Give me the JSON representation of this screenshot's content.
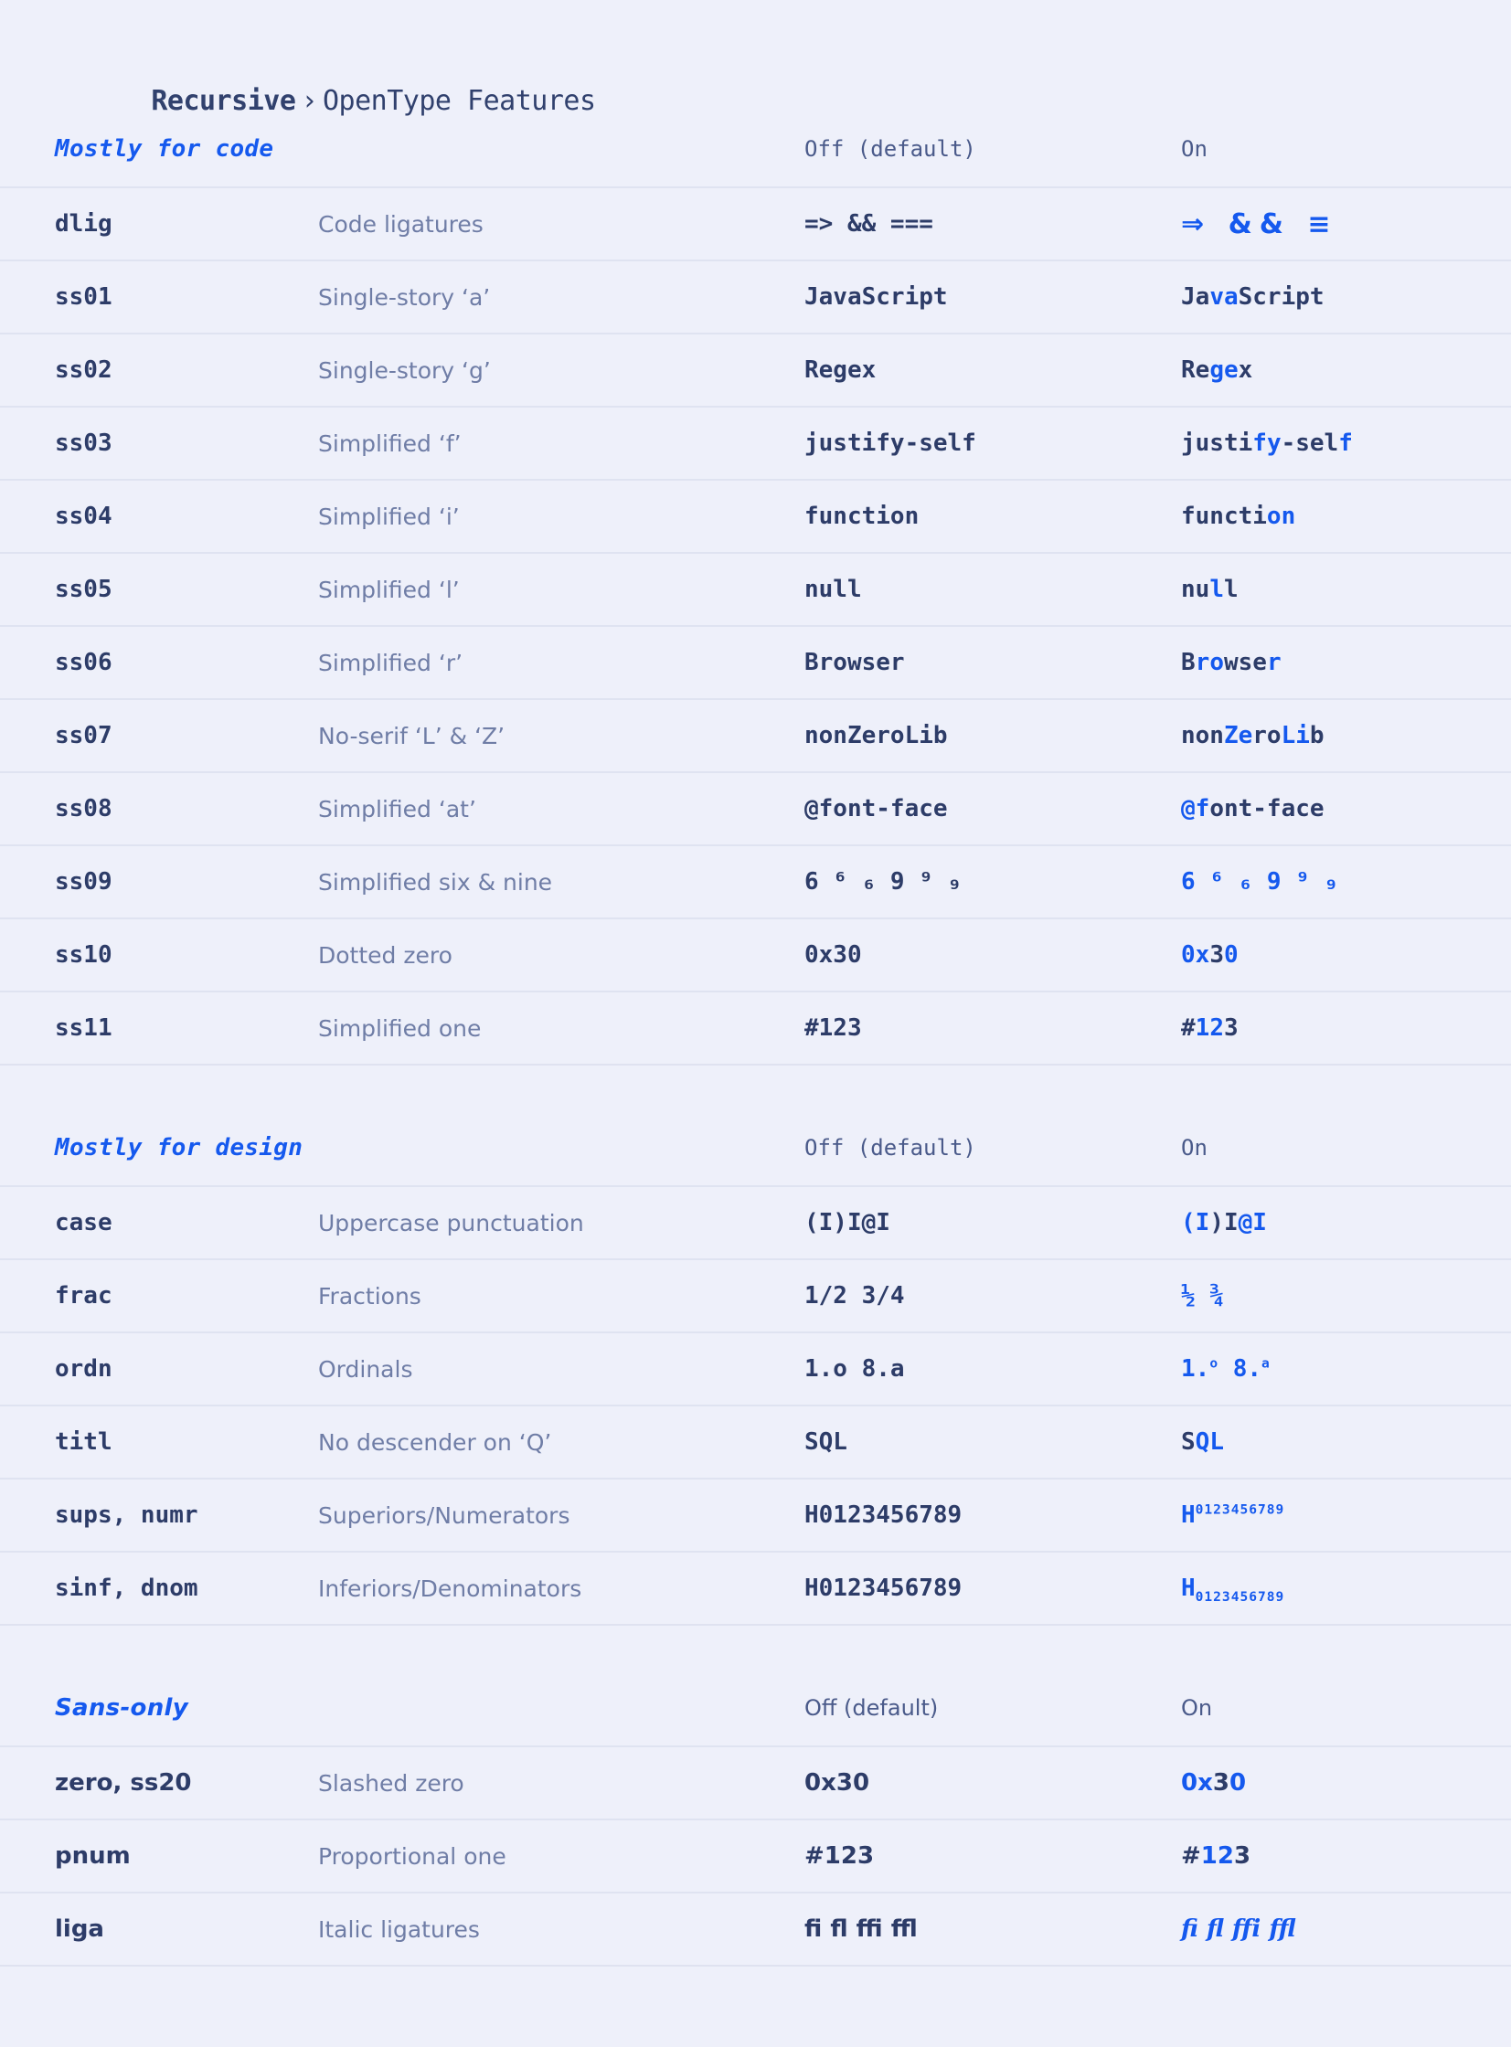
{
  "header": {
    "crumb_1": "Recursive",
    "separator": "›",
    "crumb_2": "OpenType Features"
  },
  "columns": {
    "off_label": "Off (default)",
    "on_label": "On"
  },
  "colors": {
    "page_background": "#eef0fa",
    "accent_blue": "#1559ee",
    "text_dark": "#2d3c68",
    "text_muted": "#6f7da6",
    "row_border": "#dfe3f1"
  },
  "sections": [
    {
      "title": "Mostly for code",
      "off_label": "Off (default)",
      "on_label": "On",
      "rows": [
        {
          "tag": "dlig",
          "desc": "Code ligatures",
          "off": "=> && ===",
          "on": "⇒ && ≡",
          "on_style": "ligature"
        },
        {
          "tag": "ss01",
          "desc": "Single-story ‘a’",
          "off": "JavaScript",
          "on": "JavaScript",
          "hl": [
            2,
            3
          ]
        },
        {
          "tag": "ss02",
          "desc": "Single-story ‘g’",
          "off": "Regex",
          "on": "Regex",
          "hl": [
            2,
            3
          ]
        },
        {
          "tag": "ss03",
          "desc": "Simplified ‘f’",
          "off": "justify-self",
          "on": "justify-self",
          "hl": [
            5,
            6,
            11,
            12
          ]
        },
        {
          "tag": "ss04",
          "desc": "Simplified ‘i’",
          "off": "function",
          "on": "function",
          "hl": [
            6,
            7
          ]
        },
        {
          "tag": "ss05",
          "desc": "Simplified ‘l’",
          "off": "null",
          "on": "null",
          "hl": [
            2,
            4
          ]
        },
        {
          "tag": "ss06",
          "desc": "Simplified ‘r’",
          "off": "Browser",
          "on": "Browser",
          "hl": [
            1,
            2,
            6,
            7
          ]
        },
        {
          "tag": "ss07",
          "desc": "No-serif ‘L’ & ‘Z’",
          "off": "nonZeroLib",
          "on": "nonZeroLib",
          "hl": [
            3,
            4,
            7,
            8
          ]
        },
        {
          "tag": "ss08",
          "desc": "Simplified ‘at’",
          "off": "@font-face",
          "on": "@font-face",
          "hl": [
            0,
            1
          ]
        },
        {
          "tag": "ss09",
          "desc": "Simplified six & nine",
          "off": "6 ⁶ ₆ 9 ⁹ ₉",
          "on": "6 ⁶ ₆ 9 ⁹ ₉",
          "on_style": "digits-blue"
        },
        {
          "tag": "ss10",
          "desc": "Dotted zero",
          "off": "0x30",
          "on": "0x30",
          "hl": [
            0,
            1,
            3,
            4
          ]
        },
        {
          "tag": "ss11",
          "desc": "Simplified one",
          "off": "#123",
          "on": "#123",
          "hl": [
            1,
            2
          ]
        }
      ]
    },
    {
      "title": "Mostly for design",
      "off_label": "Off (default)",
      "on_label": "On",
      "rows": [
        {
          "tag": "case",
          "desc": "Uppercase punctuation",
          "off": "(I)I@I",
          "on": "(I)I@I",
          "hl": [
            0,
            1,
            4,
            5
          ]
        },
        {
          "tag": "frac",
          "desc": "Fractions",
          "off": "1/2 3/4",
          "on": "½ ¾",
          "on_style": "all-blue"
        },
        {
          "tag": "ordn",
          "desc": "Ordinals",
          "off": "1.o 8.a",
          "on": "1.ᵒ 8.ᵃ",
          "on_style": "ordinal"
        },
        {
          "tag": "titl",
          "desc": "No descender on ‘Q’",
          "off": "SQL",
          "on": "SQL",
          "hl": [
            1,
            2
          ]
        },
        {
          "tag": "sups, numr",
          "desc": "Superiors/Numerators",
          "off": "H0123456789",
          "on": "H0123456789",
          "on_style": "superior"
        },
        {
          "tag": "sinf, dnom",
          "desc": "Inferiors/Denominators",
          "off": "H0123456789",
          "on": "H0123456789",
          "on_style": "inferior"
        }
      ]
    },
    {
      "title": "Sans-only",
      "off_label": "Off (default)",
      "on_label": "On",
      "sans": true,
      "rows": [
        {
          "tag": "zero, ss20",
          "desc": "Slashed zero",
          "off": "0x30",
          "on": "0x30",
          "hl": [
            0,
            1,
            3,
            4
          ]
        },
        {
          "tag": "pnum",
          "desc": "Proportional one",
          "off": "#123",
          "on": "#123",
          "hl": [
            1,
            2
          ]
        },
        {
          "tag": "liga",
          "desc": "Italic ligatures",
          "off": "fi fl ffi ffl",
          "on": "fi fl ffi ffl",
          "on_style": "italic-lig"
        }
      ]
    }
  ]
}
